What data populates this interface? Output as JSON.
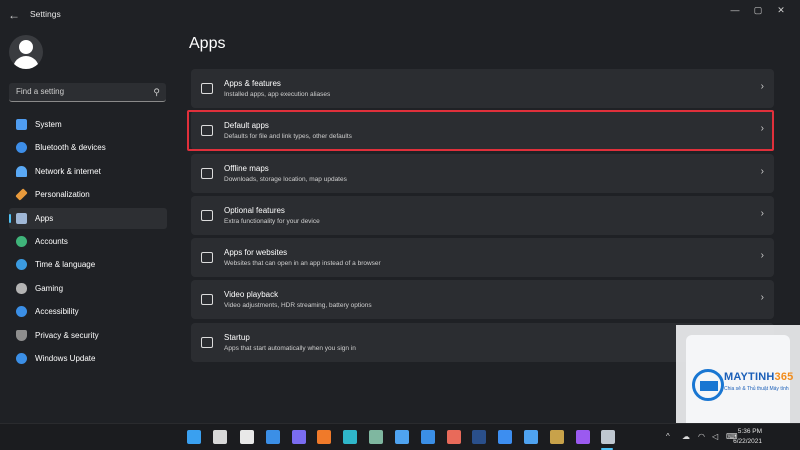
{
  "window": {
    "title": "Settings",
    "minimize": "—",
    "maximize": "▢",
    "close": "✕"
  },
  "sidebar": {
    "search_placeholder": "Find a setting",
    "items": [
      {
        "label": "System",
        "icon": "monitor-icon",
        "color": "#4f9cf0"
      },
      {
        "label": "Bluetooth & devices",
        "icon": "bluetooth-icon",
        "color": "#3d8ee8"
      },
      {
        "label": "Network & internet",
        "icon": "wifi-icon",
        "color": "#5aa9f5"
      },
      {
        "label": "Personalization",
        "icon": "brush-icon",
        "color": "#e89a3c"
      },
      {
        "label": "Apps",
        "icon": "apps-icon",
        "color": "#9fb7d6",
        "active": true
      },
      {
        "label": "Accounts",
        "icon": "person-icon",
        "color": "#3fb47a"
      },
      {
        "label": "Time & language",
        "icon": "globe-clock-icon",
        "color": "#3b9be0"
      },
      {
        "label": "Gaming",
        "icon": "controller-icon",
        "color": "#b4b4b4"
      },
      {
        "label": "Accessibility",
        "icon": "accessibility-icon",
        "color": "#3b8fe6"
      },
      {
        "label": "Privacy & security",
        "icon": "shield-icon",
        "color": "#8e8e8e"
      },
      {
        "label": "Windows Update",
        "icon": "update-icon",
        "color": "#3b8fe6"
      }
    ]
  },
  "main": {
    "title": "Apps",
    "rows": [
      {
        "title": "Apps & features",
        "subtitle": "Installed apps, app execution aliases",
        "icon": "list-icon"
      },
      {
        "title": "Default apps",
        "subtitle": "Defaults for file and link types, other defaults",
        "icon": "default-apps-icon",
        "highlighted": true
      },
      {
        "title": "Offline maps",
        "subtitle": "Downloads, storage location, map updates",
        "icon": "map-icon"
      },
      {
        "title": "Optional features",
        "subtitle": "Extra functionality for your device",
        "icon": "add-feature-icon"
      },
      {
        "title": "Apps for websites",
        "subtitle": "Websites that can open in an app instead of a browser",
        "icon": "link-window-icon"
      },
      {
        "title": "Video playback",
        "subtitle": "Video adjustments, HDR streaming, battery options",
        "icon": "video-icon"
      },
      {
        "title": "Startup",
        "subtitle": "Apps that start automatically when you sign in",
        "icon": "startup-icon"
      }
    ],
    "chevron": "›"
  },
  "watermark": {
    "name_main": "MAYTINH",
    "name_accent": "365",
    "tagline": "Chia sẻ & Thủ thuật Máy tính"
  },
  "taskbar": {
    "icons": [
      {
        "name": "start-icon",
        "color": "#3aa0f0"
      },
      {
        "name": "search-icon",
        "color": "#d8d8d8"
      },
      {
        "name": "task-view-icon",
        "color": "#e8e8e8"
      },
      {
        "name": "widgets-icon",
        "color": "#3b8fe6"
      },
      {
        "name": "chat-icon",
        "color": "#7a6cf0"
      },
      {
        "name": "firefox-icon",
        "color": "#f07a2a"
      },
      {
        "name": "edge-icon",
        "color": "#2fb6c9"
      },
      {
        "name": "linux-app-icon",
        "color": "#7fb7a0"
      },
      {
        "name": "store-icon",
        "color": "#4fa3f0"
      },
      {
        "name": "mail-icon",
        "color": "#3b8fe6"
      },
      {
        "name": "apps-grid-icon",
        "color": "#e86a5a"
      },
      {
        "name": "photoshop-icon",
        "color": "#2a4f8a"
      },
      {
        "name": "zoom-icon",
        "color": "#3d8ef0"
      },
      {
        "name": "notes-icon",
        "color": "#4fa3f0"
      },
      {
        "name": "tools-icon",
        "color": "#c8a24a"
      },
      {
        "name": "messenger-icon",
        "color": "#9b5af0"
      },
      {
        "name": "settings-icon",
        "color": "#bfc7d0"
      }
    ],
    "tray": {
      "chevron": "^",
      "time": "5:36 PM",
      "date": "6/22/2021"
    }
  }
}
